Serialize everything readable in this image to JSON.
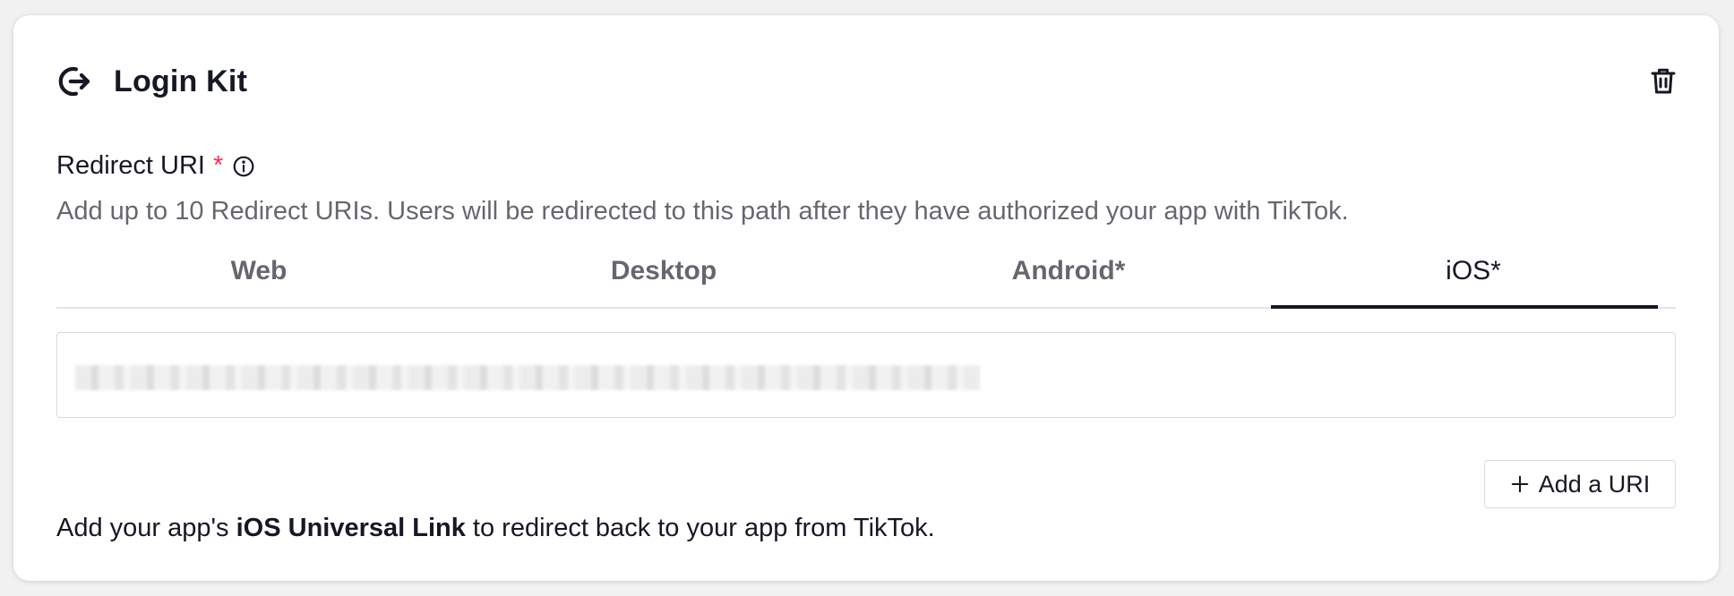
{
  "card": {
    "title": "Login Kit",
    "title_icon": "logout-arrow-icon",
    "delete_icon": "trash-icon"
  },
  "redirect": {
    "label": "Redirect URI",
    "required_mark": "*",
    "info_icon": "info-icon",
    "description": "Add up to 10 Redirect URIs. Users will be redirected to this path after they have authorized your app with TikTok."
  },
  "tabs": [
    {
      "label": "Web",
      "active": false
    },
    {
      "label": "Desktop",
      "active": false
    },
    {
      "label": "Android*",
      "active": false
    },
    {
      "label": "iOS*",
      "active": true
    }
  ],
  "uri_input": {
    "value_obscured": true
  },
  "add_button": {
    "label": "Add a URI",
    "icon": "plus-icon"
  },
  "footer": {
    "prefix": "Add your app's ",
    "bold": "iOS Universal Link",
    "suffix": " to redirect back to your app from TikTok."
  },
  "colors": {
    "required": "#fe2c55",
    "text": "#161823",
    "muted": "#6b6c73",
    "border": "#d9d9dc"
  }
}
